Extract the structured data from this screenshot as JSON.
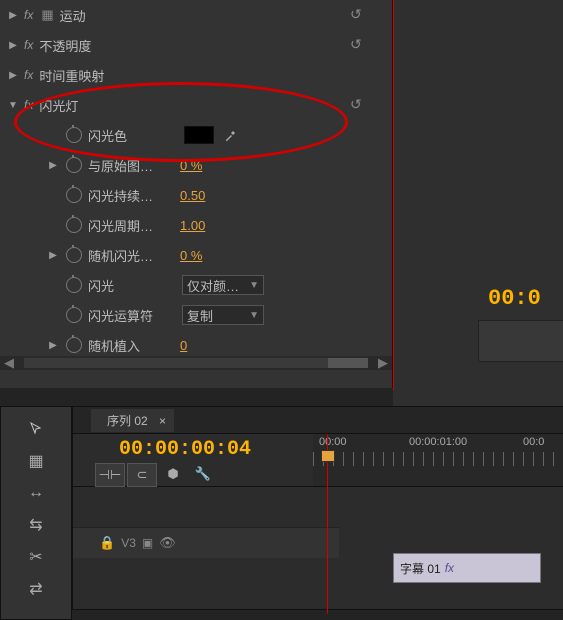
{
  "effects": {
    "builtin": [
      {
        "name": "运动"
      },
      {
        "name": "不透明度"
      },
      {
        "name": "时间重映射"
      }
    ],
    "strobe": {
      "name": "闪光灯",
      "params": {
        "color": {
          "label": "闪光色"
        },
        "blend": {
          "label": "与原始图…",
          "value": "0 %"
        },
        "duration": {
          "label": "闪光持续…",
          "value": "0.50"
        },
        "period": {
          "label": "闪光周期…",
          "value": "1.00"
        },
        "random": {
          "label": "随机闪光…",
          "value": "0 %"
        },
        "mode": {
          "label": "闪光",
          "value": "仅对颜…"
        },
        "op": {
          "label": "闪光运算符",
          "value": "复制"
        },
        "seed": {
          "label": "随机植入",
          "value": "0"
        }
      }
    }
  },
  "panel_tc": "00:00:00:04",
  "right_tc": "00:0",
  "timeline": {
    "tab": "序列 02",
    "tc": "00:00:00:04",
    "ruler": {
      "t0": "00:00",
      "t1": "00:00:01:00",
      "t2": "00:0"
    },
    "track": {
      "name": "V3"
    },
    "clip": {
      "name": "字幕 01",
      "fx": "fx"
    }
  }
}
